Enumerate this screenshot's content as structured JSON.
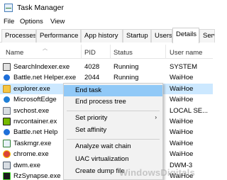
{
  "window": {
    "title": "Task Manager",
    "icon": "task-manager-icon"
  },
  "menubar": {
    "items": [
      "File",
      "Options",
      "View"
    ]
  },
  "tabs": [
    "Processes",
    "Performance",
    "App history",
    "Startup",
    "Users",
    "Details",
    "Serv"
  ],
  "active_tab": "Details",
  "columns": {
    "name": "Name",
    "pid": "PID",
    "status": "Status",
    "user": "User name"
  },
  "rows": [
    {
      "name": "SearchIndexer.exe",
      "pid": "4028",
      "status": "Running",
      "user": "SYSTEM",
      "icon": "search-indexer-icon"
    },
    {
      "name": "Battle.net Helper.exe",
      "pid": "2044",
      "status": "Running",
      "user": "WaiHoe",
      "icon": "battlenet-icon"
    },
    {
      "name": "explorer.exe",
      "pid": "",
      "status": "",
      "user": "WaiHoe",
      "icon": "folder-icon",
      "selected": true
    },
    {
      "name": "MicrosoftEdge",
      "pid": "",
      "status": "",
      "user": "WaiHoe",
      "icon": "edge-icon"
    },
    {
      "name": "svchost.exe",
      "pid": "",
      "status": "",
      "user": "LOCAL SE...",
      "icon": "svchost-icon"
    },
    {
      "name": "nvcontainer.ex",
      "pid": "",
      "status": "",
      "user": "WaiHoe",
      "icon": "nvidia-icon"
    },
    {
      "name": "Battle.net Help",
      "pid": "",
      "status": "",
      "user": "WaiHoe",
      "icon": "battlenet-icon"
    },
    {
      "name": "Taskmgr.exe",
      "pid": "",
      "status": "",
      "user": "WaiHoe",
      "icon": "task-manager-icon"
    },
    {
      "name": "chrome.exe",
      "pid": "",
      "status": "",
      "user": "WaiHoe",
      "icon": "chrome-icon"
    },
    {
      "name": "dwm.exe",
      "pid": "",
      "status": "",
      "user": "DWM-3",
      "icon": "dwm-icon"
    },
    {
      "name": "RzSynapse.exe",
      "pid": "",
      "status": "",
      "user": "WaiHoe",
      "icon": "razer-icon"
    }
  ],
  "context_menu": {
    "items": [
      {
        "label": "End task",
        "hover": true
      },
      {
        "label": "End process tree"
      },
      {
        "label": "Set priority",
        "submenu": true
      },
      {
        "label": "Set affinity"
      },
      {
        "label": "Analyze wait chain"
      },
      {
        "label": "UAC virtualization"
      },
      {
        "label": "Create dump file"
      }
    ],
    "submenu_arrow": "›"
  },
  "watermark": "WindowsDigitals"
}
